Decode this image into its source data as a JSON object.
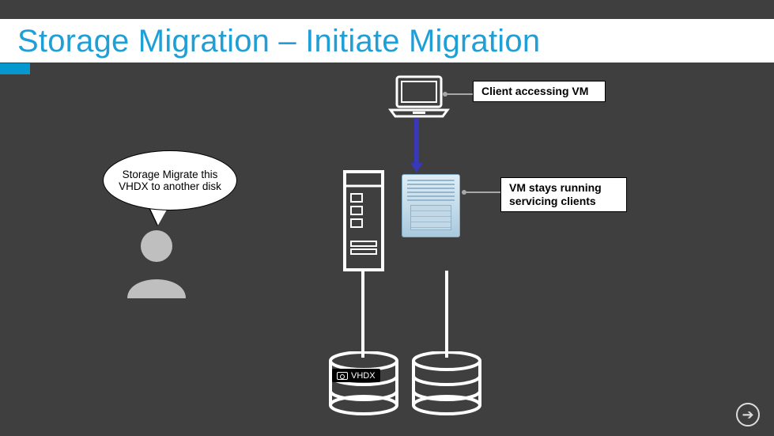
{
  "title": "Storage Migration – Initiate Migration",
  "speech_text": "Storage Migrate this VHDX to another disk",
  "labels": {
    "client": "Client accessing VM",
    "vm_running": "VM stays running servicing clients"
  },
  "vhdx_label": "VHDX",
  "icons": {
    "laptop": "laptop-icon",
    "user": "user-icon",
    "server": "host-server-icon",
    "vm": "vm-server-icon",
    "disk": "disk-stack-icon",
    "next": "arrow-right-circle-icon"
  }
}
